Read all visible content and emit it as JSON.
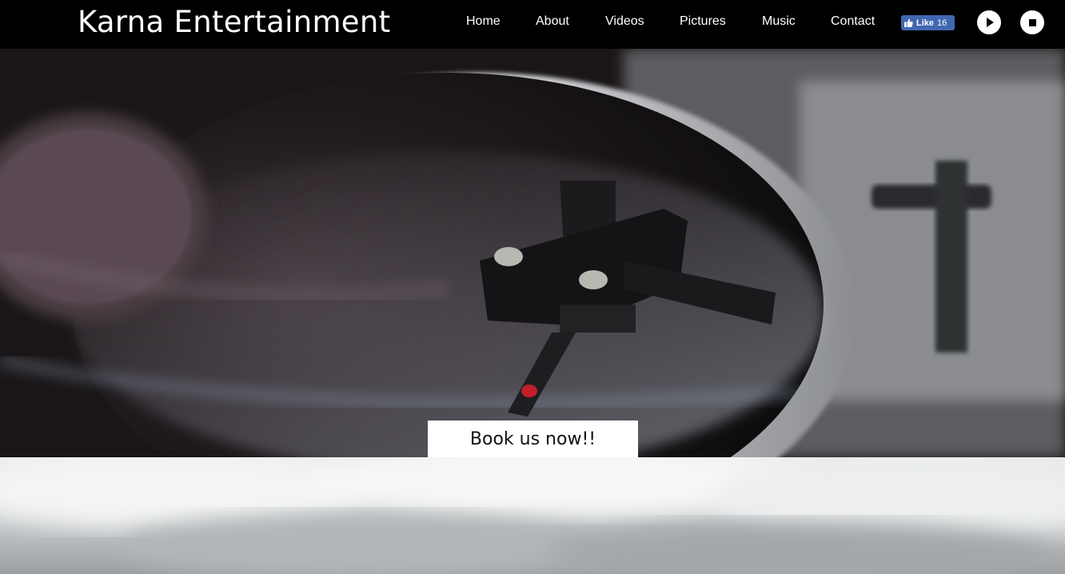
{
  "header": {
    "brand": "Karna Entertainment",
    "nav": [
      "Home",
      "About",
      "Videos",
      "Pictures",
      "Music",
      "Contact"
    ],
    "facebook": {
      "label": "Like",
      "count": "16",
      "icon": "thumbs-up-icon"
    },
    "player": {
      "play_icon": "play-icon",
      "stop_icon": "stop-icon"
    }
  },
  "hero": {
    "image_subject": "turntable-stylus-on-vinyl-record",
    "cta_label": "Book us now!!"
  },
  "colors": {
    "header_bg": "#000000",
    "facebook_blue": "#4267b2",
    "cta_bg": "#ffffff",
    "text_light": "#ffffff"
  }
}
